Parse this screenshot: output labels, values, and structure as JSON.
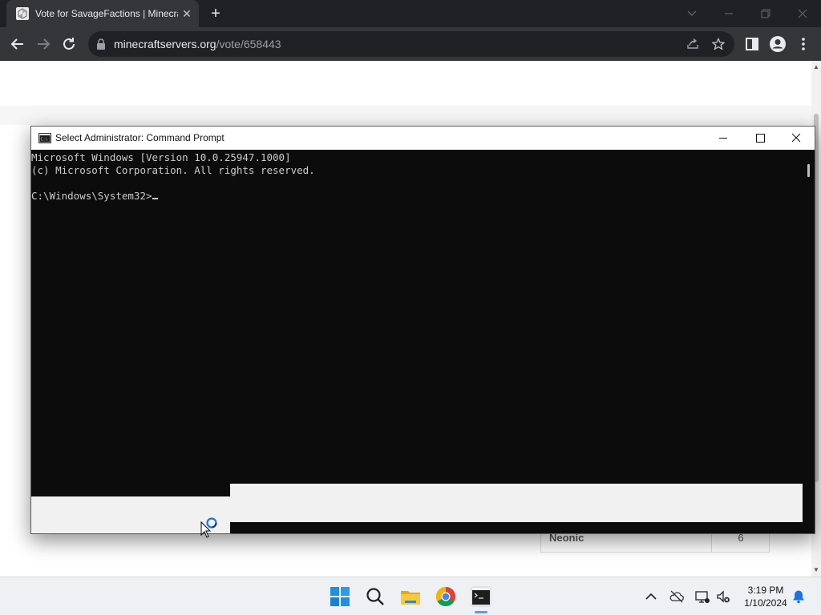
{
  "browser": {
    "tab": {
      "title": "Vote for SavageFactions | Minecraft",
      "close": "✕",
      "favicon": "site-logo-icon"
    },
    "new_tab": "+",
    "address": {
      "domain": "minecraftservers.org",
      "path": "/vote/658443"
    },
    "window_controls": [
      "chevron-down-icon",
      "minimize-icon",
      "restore-icon",
      "close-icon"
    ],
    "toolbar_icons": [
      "back-arrow-icon",
      "forward-arrow-icon",
      "reload-icon",
      "lock-icon",
      "share-icon",
      "star-icon",
      "side-panel-icon",
      "profile-icon",
      "more-icon"
    ]
  },
  "page": {
    "table_row": {
      "name": "Neonic",
      "value": "6"
    }
  },
  "cmd": {
    "title": "Select Administrator: Command Prompt",
    "lines": [
      "Microsoft Windows [Version 10.0.25947.1000]",
      "(c) Microsoft Corporation. All rights reserved."
    ],
    "prompt": "C:\\Windows\\System32>"
  },
  "taskbar": {
    "apps": [
      "windows-start-icon",
      "search-icon",
      "file-explorer-icon",
      "chrome-icon",
      "terminal-icon"
    ],
    "tray": [
      "chevron-up-icon",
      "onedrive-icon",
      "network-icon",
      "volume-muted-icon",
      "notification-bell-icon"
    ],
    "time": "3:19 PM",
    "date": "1/10/2024"
  },
  "colors": {
    "chrome_dark": "#202124",
    "chrome_toolbar": "#35363a",
    "console_bg": "#0c0c0c",
    "console_text": "#cccccc",
    "accent_blue": "#0078d4"
  }
}
